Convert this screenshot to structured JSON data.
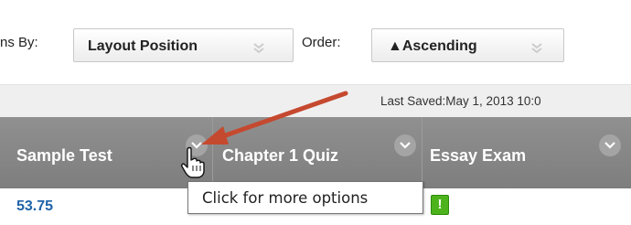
{
  "toolbar": {
    "columns_by_label": "ns By:",
    "columns_by_value": "Layout Position",
    "order_label": "Order:",
    "order_value": "▲Ascending"
  },
  "saved": {
    "text": "Last Saved:May 1, 2013 10:0"
  },
  "grid": {
    "columns": [
      {
        "title": "Sample Test"
      },
      {
        "title": "Chapter 1 Quiz"
      },
      {
        "title": "Essay Exam"
      }
    ],
    "row": {
      "score": "53.75",
      "needs_grading_glyph": "!"
    }
  },
  "tooltip": {
    "text": "Click for more options"
  },
  "colors": {
    "header_bg": "#878787",
    "score_link": "#1f63a8",
    "annotation_arrow": "#c5492f",
    "needs_grading": "#4db31c"
  }
}
